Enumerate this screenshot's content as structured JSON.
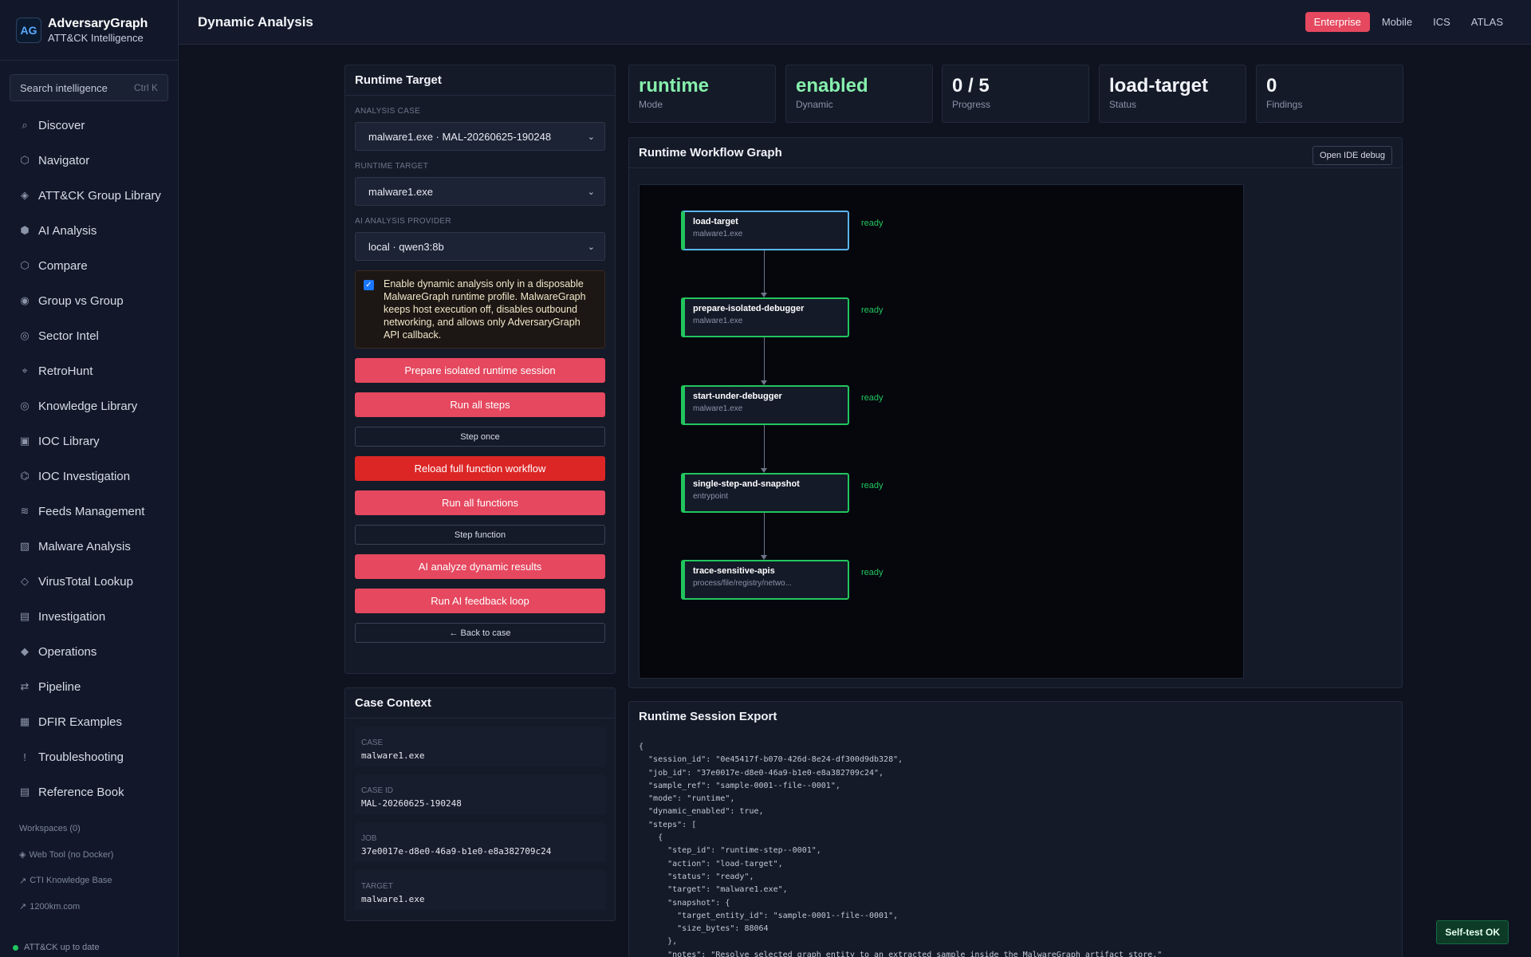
{
  "app": {
    "name": "AdversaryGraph",
    "subtitle": "ATT&CK Intelligence",
    "logo": "AG"
  },
  "search": {
    "placeholder": "Search intelligence",
    "shortcut": "Ctrl K"
  },
  "sidebar": {
    "items": [
      {
        "label": "Discover",
        "icon": "⌕"
      },
      {
        "label": "Navigator",
        "icon": "⬡"
      },
      {
        "label": "ATT&CK Group Library",
        "icon": "◈"
      },
      {
        "label": "AI Analysis",
        "icon": "⬢"
      },
      {
        "label": "Compare",
        "icon": "⬡"
      },
      {
        "label": "Group vs Group",
        "icon": "◉"
      },
      {
        "label": "Sector Intel",
        "icon": "◎"
      },
      {
        "label": "RetroHunt",
        "icon": "⌖"
      },
      {
        "label": "Knowledge Library",
        "icon": "◎"
      },
      {
        "label": "IOC Library",
        "icon": "▣"
      },
      {
        "label": "IOC Investigation",
        "icon": "⌬"
      },
      {
        "label": "Feeds Management",
        "icon": "≋"
      },
      {
        "label": "Malware Analysis",
        "icon": "▧"
      },
      {
        "label": "VirusTotal Lookup",
        "icon": "◇"
      },
      {
        "label": "Investigation",
        "icon": "▤"
      },
      {
        "label": "Operations",
        "icon": "◆"
      },
      {
        "label": "Pipeline",
        "icon": "⇄"
      },
      {
        "label": "DFIR Examples",
        "icon": "▦"
      },
      {
        "label": "Troubleshooting",
        "icon": "!"
      },
      {
        "label": "Reference Book",
        "icon": "▤"
      }
    ],
    "workspaces": "Workspaces (0)",
    "web_tool": "Web Tool (no Docker)",
    "cti_kb": "CTI Knowledge Base",
    "site": "1200km.com",
    "status": "ATT&CK up to date"
  },
  "header": {
    "title": "Dynamic Analysis",
    "domains": [
      "Enterprise",
      "Mobile",
      "ICS",
      "ATLAS"
    ],
    "active_domain": "Enterprise"
  },
  "runtime_target": {
    "title": "Runtime Target",
    "analysis_case_label": "ANALYSIS CASE",
    "analysis_case_value": "malware1.exe · MAL-20260625-190248",
    "runtime_target_label": "RUNTIME TARGET",
    "runtime_target_value": "malware1.exe",
    "ai_provider_label": "AI ANALYSIS PROVIDER",
    "ai_provider_value": "local · qwen3:8b",
    "consent_text": "Enable dynamic analysis only in a disposable MalwareGraph runtime profile. MalwareGraph keeps host execution off, disables outbound networking, and allows only AdversaryGraph API callback.",
    "consent_checked": true,
    "buttons": {
      "prepare": "Prepare isolated runtime session",
      "run_all_steps": "Run all steps",
      "step_once": "Step once",
      "reload": "Reload full function workflow",
      "run_all_functions": "Run all functions",
      "step_function": "Step function",
      "ai_analyze": "AI analyze dynamic results",
      "ai_feedback": "Run AI feedback loop",
      "back": "← Back to case"
    }
  },
  "case_context": {
    "title": "Case Context",
    "case_label": "CASE",
    "case_value": "malware1.exe",
    "case_id_label": "CASE ID",
    "case_id_value": "MAL-20260625-190248",
    "job_label": "JOB",
    "job_value": "37e0017e-d8e0-46a9-b1e0-e8a382709c24",
    "target_label": "TARGET",
    "target_value": "malware1.exe"
  },
  "stats": [
    {
      "value": "runtime",
      "label": "Mode",
      "green": true
    },
    {
      "value": "enabled",
      "label": "Dynamic",
      "green": true
    },
    {
      "value": "0 / 5",
      "label": "Progress",
      "green": false
    },
    {
      "value": "load-target",
      "label": "Status",
      "green": false
    },
    {
      "value": "0",
      "label": "Findings",
      "green": false
    }
  ],
  "workflow": {
    "title": "Runtime Workflow Graph",
    "ide_button": "Open IDE debug",
    "nodes": [
      {
        "title": "load-target",
        "sub": "malware1.exe",
        "status": "ready",
        "selected": true
      },
      {
        "title": "prepare-isolated-debugger",
        "sub": "malware1.exe",
        "status": "ready"
      },
      {
        "title": "start-under-debugger",
        "sub": "malware1.exe",
        "status": "ready"
      },
      {
        "title": "single-step-and-snapshot",
        "sub": "entrypoint",
        "status": "ready"
      },
      {
        "title": "trace-sensitive-apis",
        "sub": "process/file/registry/netwo...",
        "status": "ready"
      }
    ]
  },
  "export": {
    "title": "Runtime Session Export",
    "json_text": "{\n  \"session_id\": \"0e45417f-b070-426d-8e24-df300d9db328\",\n  \"job_id\": \"37e0017e-d8e0-46a9-b1e0-e8a382709c24\",\n  \"sample_ref\": \"sample-0001--file--0001\",\n  \"mode\": \"runtime\",\n  \"dynamic_enabled\": true,\n  \"steps\": [\n    {\n      \"step_id\": \"runtime-step--0001\",\n      \"action\": \"load-target\",\n      \"status\": \"ready\",\n      \"target\": \"malware1.exe\",\n      \"snapshot\": {\n        \"target_entity_id\": \"sample-0001--file--0001\",\n        \"size_bytes\": 88064\n      },\n      \"notes\": \"Resolve selected graph entity to an extracted sample inside the MalwareGraph artifact store.\""
  },
  "toast": "Self-test OK"
}
